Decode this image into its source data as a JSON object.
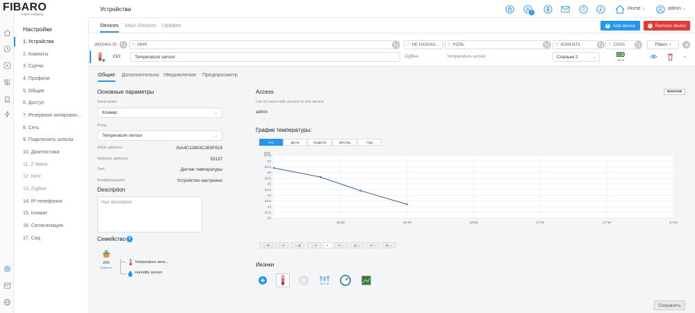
{
  "logo": {
    "brand": "FIBARO",
    "sub": "a Nice company"
  },
  "header": {
    "title": "Устройства",
    "home_label": "Home",
    "admin_label": "admin",
    "notification_count": "1"
  },
  "sidebar": {
    "title": "Настройки",
    "items": [
      {
        "label": "1. Устройства"
      },
      {
        "label": "2. Комнаты"
      },
      {
        "label": "3. Сцены"
      },
      {
        "label": "4. Профили"
      },
      {
        "label": "5. Общие"
      },
      {
        "label": "6. Доступ"
      },
      {
        "label": "7. Резервное копирован..."
      },
      {
        "label": "8. Сеть"
      },
      {
        "label": "9. Подключить шлюзы"
      },
      {
        "label": "10. Диагностика"
      },
      {
        "label": "11. Z-Wave"
      },
      {
        "label": "12. Nice"
      },
      {
        "label": "13. ZigBee"
      },
      {
        "label": "14. IP-телефония"
      },
      {
        "label": "15. Климат"
      },
      {
        "label": "16. Сигнализация"
      },
      {
        "label": "17. Сад"
      }
    ]
  },
  "top_tabs": [
    "Devices",
    "Main Devices",
    "Updates"
  ],
  "buttons": {
    "add": "Add device",
    "remove": "Remove device",
    "filters": "Filters",
    "manage": "MANAGE",
    "save": "Сохранить"
  },
  "filters": {
    "icon_id": "ИКОНКА ID",
    "name": "ИМЯ",
    "unassigned": "НЕ НАЗНАЧ...",
    "role": "РОЛЬ",
    "room": "КОМНАТА",
    "power": "СИЛА"
  },
  "device": {
    "id": "210",
    "name": "Temperature sensor",
    "protocol": "ZigBee",
    "role": "Temperature sensor",
    "room": "Спальня 2",
    "battery": "90 %",
    "battery_level": 0.9
  },
  "detail_tabs": [
    "Общие",
    "Дополнительно",
    "Уведомления",
    "Предпросмотр"
  ],
  "main_params": {
    "title": "Основные параметры",
    "category_label": "Категория:",
    "category_value": "Климат",
    "role_label": "Роль:",
    "role_value": "Temperature sensor",
    "ieee_label": "IEEE address:",
    "ieee_value": "0xA4C13803C2E6F819",
    "network_label": "Network address:",
    "network_value": "53137",
    "type_label": "Тип:",
    "type_value": "Датчик температуры",
    "config_label": "Конфигурация:",
    "config_value": "Устройство настроено"
  },
  "description": {
    "title": "Description",
    "placeholder": "Your description"
  },
  "family": {
    "title": "Семейство",
    "parent_id": "209",
    "parent_label": "Родитель",
    "children": [
      "Temperature sens...",
      "Humidity sensor"
    ]
  },
  "access": {
    "title": "Access",
    "subtitle": "List of users with access to this device",
    "users": [
      "admin"
    ]
  },
  "chart_section_title": "График температуры:",
  "range_buttons": [
    "ЧАС",
    "ДЕНЬ",
    "НЕДЕЛЯ",
    "МЕСЯЦ",
    "ГОД"
  ],
  "nav_buttons": [
    "← М",
    "← Н",
    "← Д",
    "← Ч",
    "•",
    "Ч →",
    "Д →",
    "Н →",
    "М →"
  ],
  "chart_data": {
    "type": "line",
    "ylabel": "[°C]",
    "y_ticks": [
      "27.5",
      "27",
      "26.5",
      "26",
      "25.5",
      "25",
      "24.5",
      "24",
      "23.5",
      "23",
      "22.5",
      "22"
    ],
    "x_ticks": [
      "16:30",
      "16:40",
      "16:50",
      "17:00",
      "17:10",
      "17:20"
    ],
    "ylim": [
      22,
      27.5
    ],
    "xlim_minutes": [
      10,
      70
    ],
    "series": [
      {
        "x_minutes": [
          10,
          17,
          23,
          30
        ],
        "y": [
          26.4,
          25.6,
          24.4,
          23.2
        ]
      }
    ]
  },
  "icons_section_title": "Иконки"
}
